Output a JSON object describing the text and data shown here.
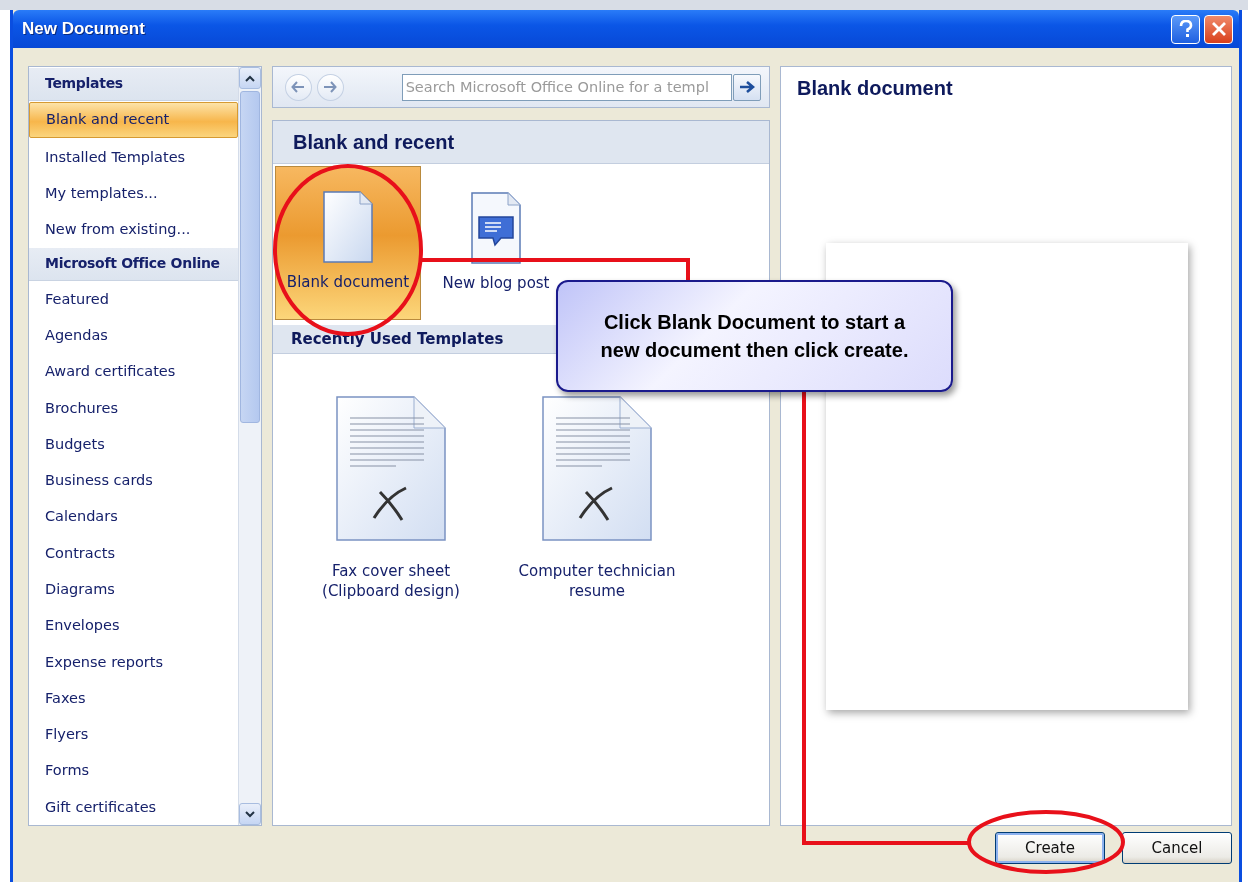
{
  "window": {
    "title": "New Document"
  },
  "sidebar": {
    "items": [
      {
        "kind": "header",
        "label": "Templates",
        "selected": false
      },
      {
        "kind": "item",
        "label": "Blank and recent",
        "selected": true
      },
      {
        "kind": "item",
        "label": "Installed Templates",
        "selected": false
      },
      {
        "kind": "item",
        "label": "My templates...",
        "selected": false
      },
      {
        "kind": "item",
        "label": "New from existing...",
        "selected": false
      },
      {
        "kind": "header",
        "label": "Microsoft Office Online",
        "selected": false
      },
      {
        "kind": "item",
        "label": "Featured",
        "selected": false
      },
      {
        "kind": "item",
        "label": "Agendas",
        "selected": false
      },
      {
        "kind": "item",
        "label": "Award certificates",
        "selected": false
      },
      {
        "kind": "item",
        "label": "Brochures",
        "selected": false
      },
      {
        "kind": "item",
        "label": "Budgets",
        "selected": false
      },
      {
        "kind": "item",
        "label": "Business cards",
        "selected": false
      },
      {
        "kind": "item",
        "label": "Calendars",
        "selected": false
      },
      {
        "kind": "item",
        "label": "Contracts",
        "selected": false
      },
      {
        "kind": "item",
        "label": "Diagrams",
        "selected": false
      },
      {
        "kind": "item",
        "label": "Envelopes",
        "selected": false
      },
      {
        "kind": "item",
        "label": "Expense reports",
        "selected": false
      },
      {
        "kind": "item",
        "label": "Faxes",
        "selected": false
      },
      {
        "kind": "item",
        "label": "Flyers",
        "selected": false
      },
      {
        "kind": "item",
        "label": "Forms",
        "selected": false
      },
      {
        "kind": "item",
        "label": "Gift certificates",
        "selected": false
      }
    ]
  },
  "toolbar": {
    "search": {
      "placeholder": "Search Microsoft Office Online for a templ"
    }
  },
  "gallery": {
    "title": "Blank and recent",
    "tiles": [
      {
        "kind": "blank",
        "label": "Blank document",
        "selected": true
      },
      {
        "kind": "blog",
        "label": "New blog post",
        "selected": false
      }
    ],
    "section": "Recently Used Templates",
    "recent": [
      {
        "label": "Fax cover sheet (Clipboard design)"
      },
      {
        "label": "Computer technician resume"
      }
    ]
  },
  "preview": {
    "title": "Blank document"
  },
  "buttons": [
    "Create",
    "Cancel"
  ],
  "callout": {
    "text": "Click Blank Document to start a new document then click create."
  }
}
